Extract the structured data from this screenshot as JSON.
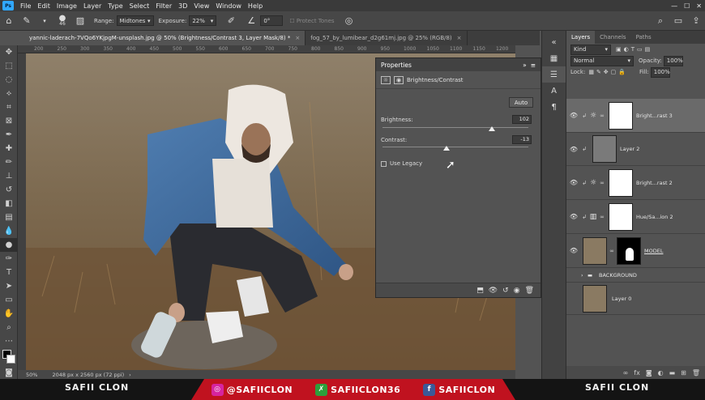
{
  "menu": [
    "File",
    "Edit",
    "Image",
    "Layer",
    "Type",
    "Select",
    "Filter",
    "3D",
    "View",
    "Window",
    "Help"
  ],
  "options": {
    "brush_size": "46",
    "range_label": "Range:",
    "range_value": "Midtones",
    "exposure_label": "Exposure:",
    "exposure_value": "22%",
    "angle_value": "0°",
    "protect_tones": "Protect Tones"
  },
  "tabs": [
    {
      "label": "yannic-laderach-7VQo6YKjpgM-unsplash.jpg @ 50% (Brightness/Contrast 3, Layer Mask/8) *",
      "close": "×"
    },
    {
      "label": "fog_57_by_lumibear_d2g61mj.jpg @ 25% (RGB/8)",
      "close": "×"
    }
  ],
  "ruler_top": [
    "200",
    "250",
    "300",
    "350",
    "400",
    "450",
    "500",
    "550",
    "600",
    "650",
    "700",
    "750",
    "800",
    "850",
    "900",
    "950",
    "1000",
    "1050",
    "1100",
    "1150",
    "1200"
  ],
  "status": {
    "zoom": "50%",
    "doc_size": "2048 px x 2560 px (72 ppi)"
  },
  "properties": {
    "title": "Properties",
    "sub_title": "Brightness/Contrast",
    "auto": "Auto",
    "brightness_label": "Brightness:",
    "brightness_value": "102",
    "brightness_level": 0.75,
    "contrast_label": "Contrast:",
    "contrast_value": "-13",
    "contrast_level": 0.44,
    "legacy_label": "Use Legacy"
  },
  "layers_panel": {
    "tabs": [
      "Layers",
      "Channels",
      "Paths"
    ],
    "kind": "Kind",
    "blend": "Normal",
    "opacity_label": "Opacity:",
    "opacity_value": "100%",
    "lock_label": "Lock:",
    "fill_label": "Fill:",
    "fill_value": "100%",
    "layers": [
      {
        "name": "Bright...rast 3"
      },
      {
        "name": "Layer 2"
      },
      {
        "name": "Bright...rast 2"
      },
      {
        "name": "Hue/Sa...ion 2"
      },
      {
        "name": "MODEL"
      },
      {
        "name": "BACKGROUND"
      },
      {
        "name": "Layer 0"
      }
    ]
  },
  "banner": {
    "left": "SAFII CLON",
    "instagram": "@SAFIICLON",
    "other": "SAFIICLON36",
    "facebook": "SAFIICLON",
    "right": "SAFII CLON"
  },
  "colors": {
    "banner_red": "#c0121f",
    "ps_blue": "#31a8ff"
  }
}
